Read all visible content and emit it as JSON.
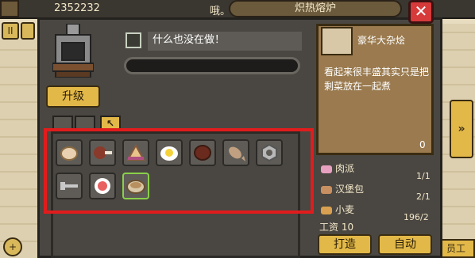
{
  "background": {
    "money": "2352232",
    "hint": "哦。",
    "staff_label": "员工",
    "left_button_glyph": "II",
    "move_glyph": "+",
    "right_arrow_glyph": "»"
  },
  "window": {
    "title": "炽热熔炉",
    "close_glyph": "✕"
  },
  "furnace": {
    "upgrade_label": "升级",
    "status_text": "什么也没在做！",
    "progress": 0
  },
  "tabs": [
    {
      "icon": "meat-tab-icon"
    },
    {
      "icon": "fish-tab-icon"
    },
    {
      "icon": "arrow-tab-icon",
      "glyph": "↖"
    }
  ],
  "inventory": {
    "slots": [
      {
        "icon": "bread-icon",
        "color": "#e8d0b0"
      },
      {
        "icon": "meat-bone-icon",
        "color": "#8a3a2a"
      },
      {
        "icon": "pie-slice-icon",
        "color": "#e8c48a"
      },
      {
        "icon": "fried-egg-icon",
        "color": "#f6d23a"
      },
      {
        "icon": "steak-icon",
        "color": "#6a2a1e"
      },
      {
        "icon": "fish-icon",
        "color": "#c0a080"
      },
      {
        "icon": "gear-nut-icon",
        "color": "#b8b8b8"
      },
      {
        "icon": "screw-icon",
        "color": "#c8c8c8"
      },
      {
        "icon": "candy-icon",
        "color": "#e86060"
      },
      {
        "icon": "soup-bowl-icon",
        "color": "#d8c8a8",
        "selected": true
      }
    ]
  },
  "recipe": {
    "name": "豪华大杂烩",
    "description": "看起来很丰盛其实只是把剩菜放在一起煮",
    "count": "0",
    "ingredients": [
      {
        "name": "肉派",
        "value": "",
        "icon": "meat-pie-icon",
        "color": "#e8a0c0"
      },
      {
        "name": "",
        "value": "1/1"
      },
      {
        "name": "汉堡包",
        "value": "",
        "icon": "burger-icon",
        "color": "#c89060"
      },
      {
        "name": "",
        "value": "2/1"
      },
      {
        "name": "小麦",
        "value": "196/2",
        "icon": "wheat-icon",
        "color": "#d8a050"
      }
    ],
    "wage_label": "工资",
    "wage_value": "10"
  },
  "actions": {
    "make_label": "打造",
    "auto_label": "自动"
  }
}
